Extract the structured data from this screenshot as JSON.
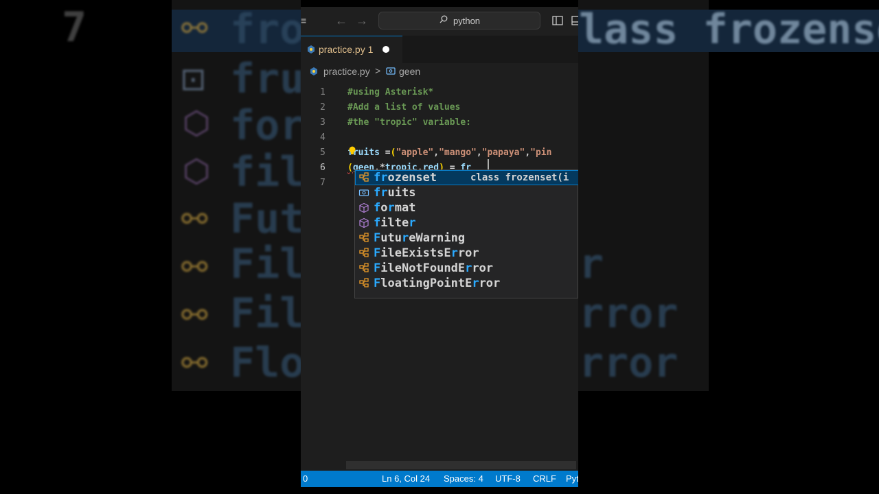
{
  "titlebar": {
    "search_text": "python"
  },
  "tab": {
    "label": "practice.py 1"
  },
  "breadcrumb": {
    "file": "practice.py",
    "separator": ">",
    "symbol": "geen"
  },
  "editor": {
    "line_numbers": [
      "1",
      "2",
      "3",
      "4",
      "5",
      "6",
      "7"
    ],
    "line1": "#using Asterisk*",
    "line2": "#Add a list of values",
    "line3": "#the \"tropic\" variable:",
    "line5": {
      "ident": "fruits",
      "eq": " =",
      "open": "(",
      "s1": "\"apple\"",
      "c1": ",",
      "s2": "\"mango\"",
      "c2": ",",
      "s3": "\"papaya\"",
      "c3": ",",
      "s4": "\"pin"
    },
    "line6": {
      "open": "(",
      "a": "geen",
      "c1": ",",
      "star": "*",
      "b": "tropic",
      "c2": ",",
      "c": "red",
      "close": ")",
      "eq": " = ",
      "typed": "fr"
    }
  },
  "suggestions": [
    {
      "icon": "class-icon",
      "pre": "",
      "h1": "fr",
      "rest": "ozenset",
      "detail": "class frozenset(i"
    },
    {
      "icon": "variable-icon",
      "pre": "",
      "h1": "fr",
      "rest": "uits",
      "detail": ""
    },
    {
      "icon": "function-icon",
      "pre": "",
      "h1": "f",
      "mid": "o",
      "h2": "r",
      "rest": "mat",
      "detail": ""
    },
    {
      "icon": "function-icon",
      "pre": "",
      "h1": "f",
      "mid": "ilte",
      "h2": "r",
      "rest": "",
      "detail": ""
    },
    {
      "icon": "class-icon",
      "pre": "",
      "h1": "F",
      "mid": "utu",
      "h2": "r",
      "rest": "eWarning",
      "detail": ""
    },
    {
      "icon": "class-icon",
      "pre": "",
      "h1": "F",
      "mid": "ileExistsE",
      "h2": "r",
      "rest": "ror",
      "detail": ""
    },
    {
      "icon": "class-icon",
      "pre": "",
      "h1": "F",
      "mid": "ileNotFoundE",
      "h2": "r",
      "rest": "ror",
      "detail": ""
    },
    {
      "icon": "class-icon",
      "pre": "",
      "h1": "F",
      "mid": "loatingPointE",
      "h2": "r",
      "rest": "ror",
      "detail": ""
    }
  ],
  "statusbar": {
    "problems": "0",
    "position": "Ln 6, Col 24",
    "spaces": "Spaces: 4",
    "encoding": "UTF-8",
    "eol": "CRLF",
    "language": "Pyt"
  },
  "background": {
    "left_line_number": "7",
    "left_rows": [
      "fro",
      "fru",
      "for",
      "fil",
      "Fut",
      "Fil",
      "Fil",
      "Flo"
    ],
    "right_rows": [
      "lass frozenset(:",
      "",
      "",
      "",
      "",
      "r",
      "rror",
      "rror"
    ]
  },
  "colors": {
    "accent": "#007acc",
    "highlight": "#2aaaff",
    "selection": "#04395e"
  }
}
